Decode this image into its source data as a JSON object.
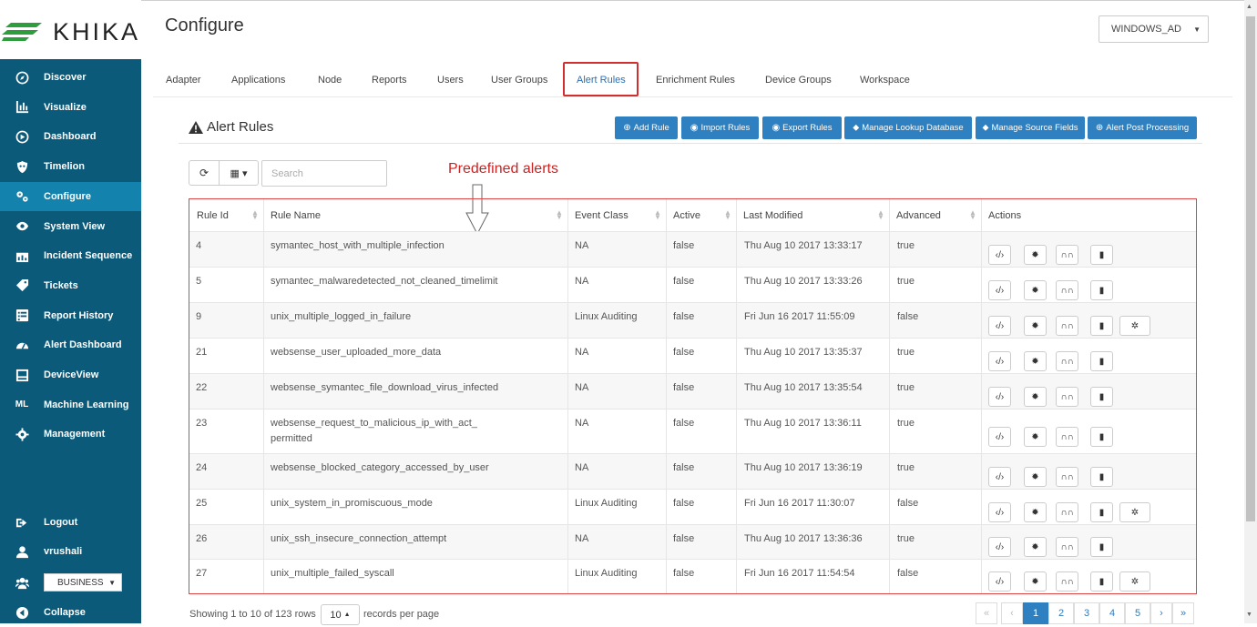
{
  "brand": {
    "name": "KHIKA",
    "color": "#2e9e3c"
  },
  "header": {
    "title": "Configure",
    "workspace_select": "WINDOWS_AD"
  },
  "sidebar": {
    "items": [
      {
        "label": "Discover",
        "icon": "compass-icon"
      },
      {
        "label": "Visualize",
        "icon": "bar-chart-icon"
      },
      {
        "label": "Dashboard",
        "icon": "dashboard-icon"
      },
      {
        "label": "Timelion",
        "icon": "shield-icon"
      },
      {
        "label": "Configure",
        "icon": "gears-icon",
        "active": true
      },
      {
        "label": "System View",
        "icon": "eye-icon"
      },
      {
        "label": "Incident Sequence",
        "icon": "incident-chart-icon"
      },
      {
        "label": "Tickets",
        "icon": "tag-icon"
      },
      {
        "label": "Report History",
        "icon": "list-icon"
      },
      {
        "label": "Alert Dashboard",
        "icon": "gauge-icon"
      },
      {
        "label": "DeviceView",
        "icon": "device-icon"
      },
      {
        "label": "Machine Learning",
        "icon": "ml-text-icon",
        "icon_text": "ML"
      },
      {
        "label": "Management",
        "icon": "cog-icon"
      }
    ],
    "logout": "Logout",
    "user": "vrushali",
    "org_select": "BUSINESS",
    "collapse": "Collapse"
  },
  "tabs": [
    "Adapter",
    "Applications",
    "Node",
    "Reports",
    "Users",
    "User Groups",
    "Alert Rules",
    "Enrichment Rules",
    "Device Groups",
    "Workspace"
  ],
  "active_tab": "Alert Rules",
  "section": {
    "title": "Alert Rules",
    "buttons": [
      "Add Rule",
      "Import Rules",
      "Export Rules",
      "Manage Lookup Database",
      "Manage Source Fields",
      "Alert Post Processing"
    ]
  },
  "search": {
    "placeholder": "Search"
  },
  "annotation": "Predefined alerts",
  "table": {
    "columns": [
      "Rule Id",
      "Rule Name",
      "Event Class",
      "Active",
      "Last Modified",
      "Advanced",
      "Actions"
    ],
    "rows": [
      {
        "id": "4",
        "name": "symantec_host_with_multiple_infection",
        "name2": "",
        "event_class": "NA",
        "active": "false",
        "modified": "Thu Aug 10 2017 13:33:17",
        "advanced": "true",
        "extra": false
      },
      {
        "id": "5",
        "name": "symantec_malwaredetected_not_cleaned_timelimit",
        "name2": "",
        "event_class": "NA",
        "active": "false",
        "modified": "Thu Aug 10 2017 13:33:26",
        "advanced": "true",
        "extra": false
      },
      {
        "id": "9",
        "name": "unix_multiple_logged_in_failure",
        "name2": "",
        "event_class": "Linux Auditing",
        "active": "false",
        "modified": "Fri Jun 16 2017 11:55:09",
        "advanced": "false",
        "extra": true
      },
      {
        "id": "21",
        "name": "websense_user_uploaded_more_data",
        "name2": "",
        "event_class": "NA",
        "active": "false",
        "modified": "Thu Aug 10 2017 13:35:37",
        "advanced": "true",
        "extra": false
      },
      {
        "id": "22",
        "name": "websense_symantec_file_download_virus_infected",
        "name2": "",
        "event_class": "NA",
        "active": "false",
        "modified": "Thu Aug 10 2017 13:35:54",
        "advanced": "true",
        "extra": false
      },
      {
        "id": "23",
        "name": "websense_request_to_malicious_ip_with_act_",
        "name2": "permitted",
        "event_class": "NA",
        "active": "false",
        "modified": "Thu Aug 10 2017 13:36:11",
        "advanced": "true",
        "extra": false
      },
      {
        "id": "24",
        "name": "websense_blocked_category_accessed_by_user",
        "name2": "",
        "event_class": "NA",
        "active": "false",
        "modified": "Thu Aug 10 2017 13:36:19",
        "advanced": "true",
        "extra": false
      },
      {
        "id": "25",
        "name": "unix_system_in_promiscuous_mode",
        "name2": "",
        "event_class": "Linux Auditing",
        "active": "false",
        "modified": "Fri Jun 16 2017 11:30:07",
        "advanced": "false",
        "extra": true
      },
      {
        "id": "26",
        "name": "unix_ssh_insecure_connection_attempt",
        "name2": "",
        "event_class": "NA",
        "active": "false",
        "modified": "Thu Aug 10 2017 13:36:36",
        "advanced": "true",
        "extra": false
      },
      {
        "id": "27",
        "name": "unix_multiple_failed_syscall",
        "name2": "",
        "event_class": "Linux Auditing",
        "active": "false",
        "modified": "Fri Jun 16 2017 11:54:54",
        "advanced": "false",
        "extra": true
      }
    ],
    "action_icons": [
      "code-icon",
      "gear-icon",
      "binoculars-icon",
      "trash-icon",
      "cogs-icon"
    ]
  },
  "footer": {
    "showing": "Showing 1 to 10 of 123 rows",
    "page_size": "10",
    "records_label": "records per page",
    "pages": [
      "«",
      "‹",
      "1",
      "2",
      "3",
      "4",
      "5",
      "›",
      "»"
    ],
    "active_page": "1"
  },
  "colors": {
    "sidebar": "#0b5a7a",
    "sidebar_active": "#1382ad",
    "button": "#2e80c0",
    "highlight": "#d12f2f"
  }
}
